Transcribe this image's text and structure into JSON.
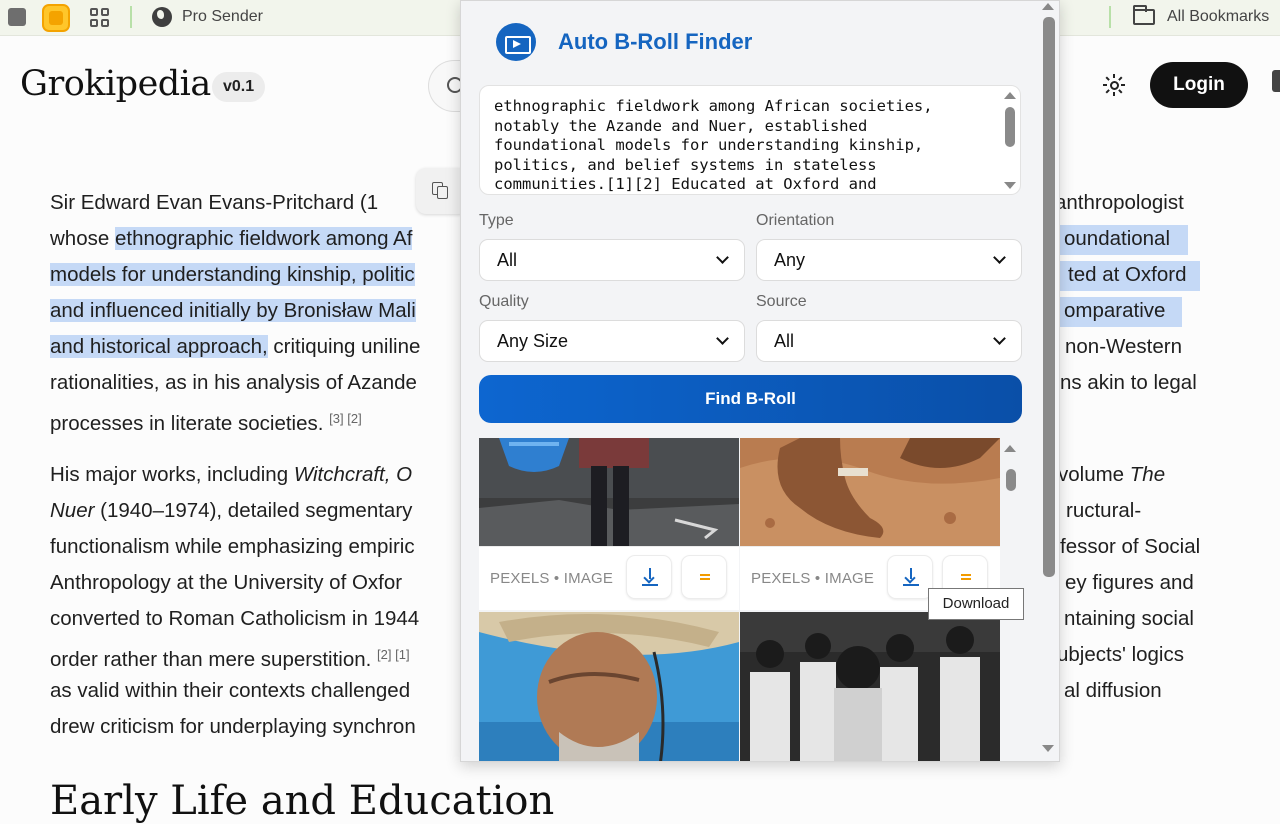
{
  "bookmarks": {
    "pro_sender": "Pro Sender",
    "all_bookmarks": "All Bookmarks"
  },
  "header": {
    "logo": "Grokipedia",
    "version": "v0.1",
    "login": "Login"
  },
  "article": {
    "p1": [
      {
        "left": "Sir Edward Evan Evans-Pritchard (1",
        "right": "anthropologist"
      },
      {
        "left_plain": "whose ",
        "left_hl": "ethnographic fieldwork among Af",
        "right": "oundational"
      },
      {
        "left_hl": "models for understanding kinship, politic",
        "right": "ted at Oxford"
      },
      {
        "left_hl": "and influenced initially by Bronisław Mali",
        "right": "omparative"
      },
      {
        "left_hl": "and historical approach,",
        "left_plain": " critiquing uniline",
        "right": "non-Western"
      },
      {
        "left": "rationalities, as in his analysis of Azande",
        "right": "ns akin to legal"
      },
      {
        "left": "processes in literate societies.",
        "sup": "[3] [2]"
      }
    ],
    "p2": [
      {
        "left": "His major works, including ",
        "left_em": "Witchcraft, O",
        "right_pre": "volume ",
        "right_em": "The"
      },
      {
        "left_em": "Nuer",
        "left": " (1940–1974), detailed segmentary",
        "right": "ructural-"
      },
      {
        "left": "functionalism while emphasizing empiric",
        "right": "fessor of Social"
      },
      {
        "left": "Anthropology at the University of Oxfor",
        "right": "ey figures and"
      },
      {
        "left": "converted to Roman Catholicism in 1944",
        "right": "ntaining social"
      },
      {
        "left": "order rather than mere superstition.",
        "sup": "[2] [1]",
        "right": "ubjects' logics"
      },
      {
        "left": "as valid within their contexts challenged",
        "right": "al diffusion"
      },
      {
        "left": "drew criticism for underplaying synchron"
      }
    ],
    "next_heading": "Early Life and Education"
  },
  "popup": {
    "title": "Auto B-Roll Finder",
    "query_text": "ethnographic fieldwork among African societies,\nnotably the Azande and Nuer, established\nfoundational models for understanding kinship,\npolitics, and belief systems in stateless\ncommunities.[1][2] Educated at Oxford and",
    "filters": {
      "type_label": "Type",
      "type_value": "All",
      "orientation_label": "Orientation",
      "orientation_value": "Any",
      "quality_label": "Quality",
      "quality_value": "Any Size",
      "source_label": "Source",
      "source_value": "All"
    },
    "find_button": "Find B-Roll",
    "results": [
      {
        "source": "PEXELS • IMAGE"
      },
      {
        "source": "PEXELS • IMAGE"
      }
    ],
    "tooltip": "Download"
  },
  "icons": [
    "tab-square-icon",
    "extension-icon",
    "apps-grid-icon",
    "globe-icon",
    "folder-icon",
    "search-icon",
    "theme-sun-icon",
    "copy-icon",
    "b-roll-logo-icon",
    "chevron-down-icon",
    "download-icon",
    "menu-icon"
  ],
  "colors": {
    "accent": "#1565c0",
    "highlight": "#c5d9f6",
    "orange": "#f29b00"
  }
}
